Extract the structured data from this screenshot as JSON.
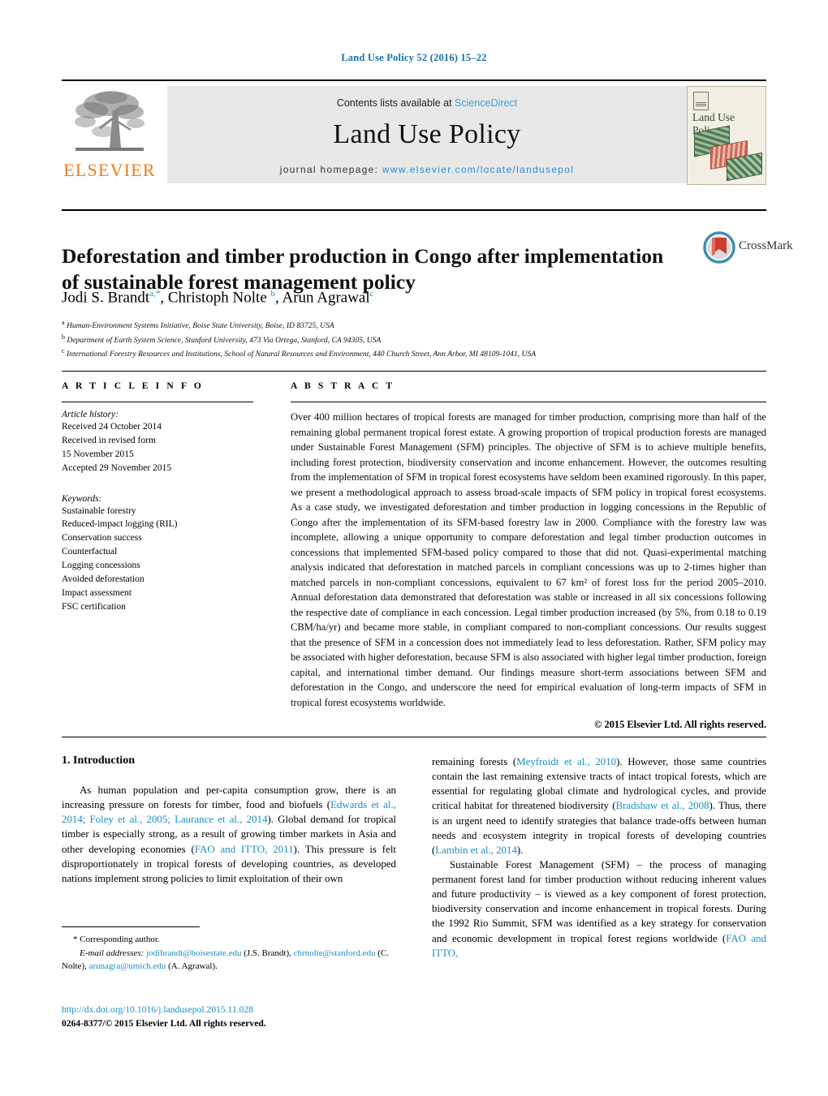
{
  "running_head": "Land Use Policy 52 (2016) 15–22",
  "masthead": {
    "contents_prefix": "Contents lists available at ",
    "sciencedirect": "ScienceDirect",
    "journal_title": "Land Use Policy",
    "homepage_label": "journal homepage:",
    "homepage_url": "www.elsevier.com/locate/landusepol",
    "publisher": "ELSEVIER",
    "cover_title": "Land Use Policy"
  },
  "article": {
    "title": "Deforestation and timber production in Congo after implementation of sustainable forest management policy",
    "crossmark_label": "CrossMark",
    "authors_html": "Jodi S. Brandt<sup>a,*</sup>, Christoph Nolte <sup>b</sup>, Arun Agrawal<sup>c</sup>",
    "affiliations": [
      {
        "marker": "a",
        "text": "Human-Environment Systems Initiative, Boise State University, Boise, ID 83725, USA"
      },
      {
        "marker": "b",
        "text": "Department of Earth System Science, Stanford University, 473 Via Ortega, Stanford, CA 94305, USA"
      },
      {
        "marker": "c",
        "text": "International Forestry Resources and Institutions, School of Natural Resources and Environment, 440 Church Street, Ann Arbor, MI 48109-1041, USA"
      }
    ]
  },
  "article_info": {
    "heading": "A R T I C L E   I N F O",
    "history_label": "Article history:",
    "history": [
      "Received 24 October 2014",
      "Received in revised form",
      "15 November 2015",
      "Accepted 29 November 2015"
    ],
    "keywords_label": "Keywords:",
    "keywords": [
      "Sustainable forestry",
      "Reduced-impact logging (RIL)",
      "Conservation success",
      "Counterfactual",
      "Logging concessions",
      "Avoided deforestation",
      "Impact assessment",
      "FSC certification"
    ]
  },
  "abstract": {
    "heading": "A B S T R A C T",
    "text": "Over 400 million hectares of tropical forests are managed for timber production, comprising more than half of the remaining global permanent tropical forest estate. A growing proportion of tropical production forests are managed under Sustainable Forest Management (SFM) principles. The objective of SFM is to achieve multiple benefits, including forest protection, biodiversity conservation and income enhancement. However, the outcomes resulting from the implementation of SFM in tropical forest ecosystems have seldom been examined rigorously. In this paper, we present a methodological approach to assess broad-scale impacts of SFM policy in tropical forest ecosystems. As a case study, we investigated deforestation and timber production in logging concessions in the Republic of Congo after the implementation of its SFM-based forestry law in 2000. Compliance with the forestry law was incomplete, allowing a unique opportunity to compare deforestation and legal timber production outcomes in concessions that implemented SFM-based policy compared to those that did not. Quasi-experimental matching analysis indicated that deforestation in matched parcels in compliant concessions was up to 2-times higher than matched parcels in non-compliant concessions, equivalent to 67 km² of forest loss for the period 2005–2010. Annual deforestation data demonstrated that deforestation was stable or increased in all six concessions following the respective date of compliance in each concession. Legal timber production increased (by 5%, from 0.18 to 0.19 CBM/ha/yr) and became more stable, in compliant compared to non-compliant concessions. Our results suggest that the presence of SFM in a concession does not immediately lead to less deforestation. Rather, SFM policy may be associated with higher deforestation, because SFM is also associated with higher legal timber production, foreign capital, and international timber demand. Our findings measure short-term associations between SFM and deforestation in the Congo, and underscore the need for empirical evaluation of long-term impacts of SFM in tropical forest ecosystems worldwide.",
    "copyright": "© 2015 Elsevier Ltd. All rights reserved."
  },
  "body": {
    "section_number_title": "1.  Introduction",
    "left_paragraph_1_part1": "As human population and per-capita consumption grow, there is an increasing pressure on forests for timber, food and biofuels (",
    "left_cite_1": "Edwards et al., 2014; Foley et al., 2005; Laurance et al., 2014",
    "left_paragraph_1_part2": "). Global demand for tropical timber is especially strong, as a result of growing timber markets in Asia and other developing economies (",
    "left_cite_2": "FAO and ITTO, 2011",
    "left_paragraph_1_part3": "). This pressure is felt disproportionately in tropical forests of developing countries, as developed nations implement strong policies to limit exploitation of their own",
    "right_paragraph_1_part1": "remaining forests (",
    "right_cite_1": "Meyfroidt et al., 2010",
    "right_paragraph_1_part2": "). However, those same countries contain the last remaining extensive tracts of intact tropical forests, which are essential for regulating global climate and hydrological cycles, and provide critical habitat for threatened biodiversity (",
    "right_cite_2": "Bradshaw et al., 2008",
    "right_paragraph_1_part3": "). Thus, there is an urgent need to identify strategies that balance trade-offs between human needs and ecosystem integrity in tropical forests of developing countries (",
    "right_cite_3": "Lambin et al., 2014",
    "right_paragraph_1_part4": ").",
    "right_paragraph_2_part1": "Sustainable Forest Management (SFM) – the process of managing permanent forest land for timber production without reducing inherent values and future productivity – is viewed as a key component of forest protection, biodiversity conservation and income enhancement in tropical forests. During the 1992 Rio Summit, SFM was identified as a key strategy for conservation and economic development in tropical forest regions worldwide (",
    "right_cite_4": "FAO and ITTO,"
  },
  "footnotes": {
    "corresponding": "* Corresponding author.",
    "email_label": "E-mail addresses:",
    "email_1": "jodibrandt@boisestate.edu",
    "email_1_name": " (J.S. Brandt),",
    "email_2": "chrnolte@stanford.edu",
    "email_2_name": " (C. Nolte), ",
    "email_3": "arunagra@umich.edu",
    "email_3_name": " (A. Agrawal).",
    "doi": "http://dx.doi.org/10.1016/j.landusepol.2015.11.028",
    "issn_line": "0264-8377/© 2015 Elsevier Ltd. All rights reserved."
  },
  "colors": {
    "link_blue": "#1a8fc1",
    "elsevier_orange": "#f07c1a",
    "masthead_grey": "#e8e8e8"
  }
}
